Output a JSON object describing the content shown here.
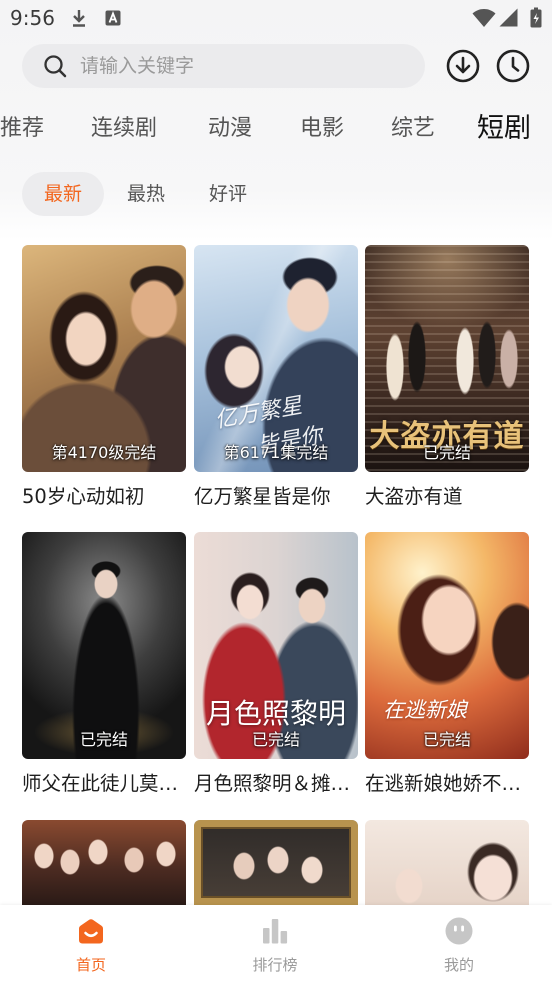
{
  "status_bar": {
    "time": "9:56"
  },
  "search": {
    "placeholder": "请输入关键字"
  },
  "icons": {
    "search": "search-icon",
    "download": "download-circle-icon",
    "history": "clock-icon"
  },
  "category_tabs": [
    {
      "label": "推荐",
      "active": false
    },
    {
      "label": "连续剧",
      "active": false
    },
    {
      "label": "动漫",
      "active": false
    },
    {
      "label": "电影",
      "active": false
    },
    {
      "label": "综艺",
      "active": false
    },
    {
      "label": "短剧",
      "active": true
    }
  ],
  "filters": [
    {
      "label": "最新",
      "active": true
    },
    {
      "label": "最热",
      "active": false
    },
    {
      "label": "好评",
      "active": false
    }
  ],
  "cards": [
    {
      "title": "50岁心动如初",
      "badge": "第4170级完结"
    },
    {
      "title": "亿万繁星皆是你",
      "badge": "第6171集完结",
      "poster_text": [
        "亿万繁星",
        "皆是你"
      ]
    },
    {
      "title": "大盗亦有道",
      "badge": "已完结",
      "poster_text": [
        "大盗亦有道"
      ]
    },
    {
      "title": "师父在此徒儿莫…",
      "badge": "已完结"
    },
    {
      "title": "月色照黎明＆摊…",
      "badge": "已完结",
      "poster_text": [
        "月色照黎明"
      ]
    },
    {
      "title": "在逃新娘她娇不…",
      "badge": "已完结",
      "poster_text": [
        "在逃新娘"
      ]
    }
  ],
  "bottom_nav": [
    {
      "label": "首页",
      "icon": "home-icon",
      "active": true
    },
    {
      "label": "排行榜",
      "icon": "ranking-icon",
      "active": false
    },
    {
      "label": "我的",
      "icon": "profile-icon",
      "active": false
    }
  ],
  "colors": {
    "accent": "#f3661e",
    "text": "#1e1e1e",
    "tab_text": "#555555",
    "muted": "#9a9a9a",
    "chip_background": "#ececee"
  }
}
